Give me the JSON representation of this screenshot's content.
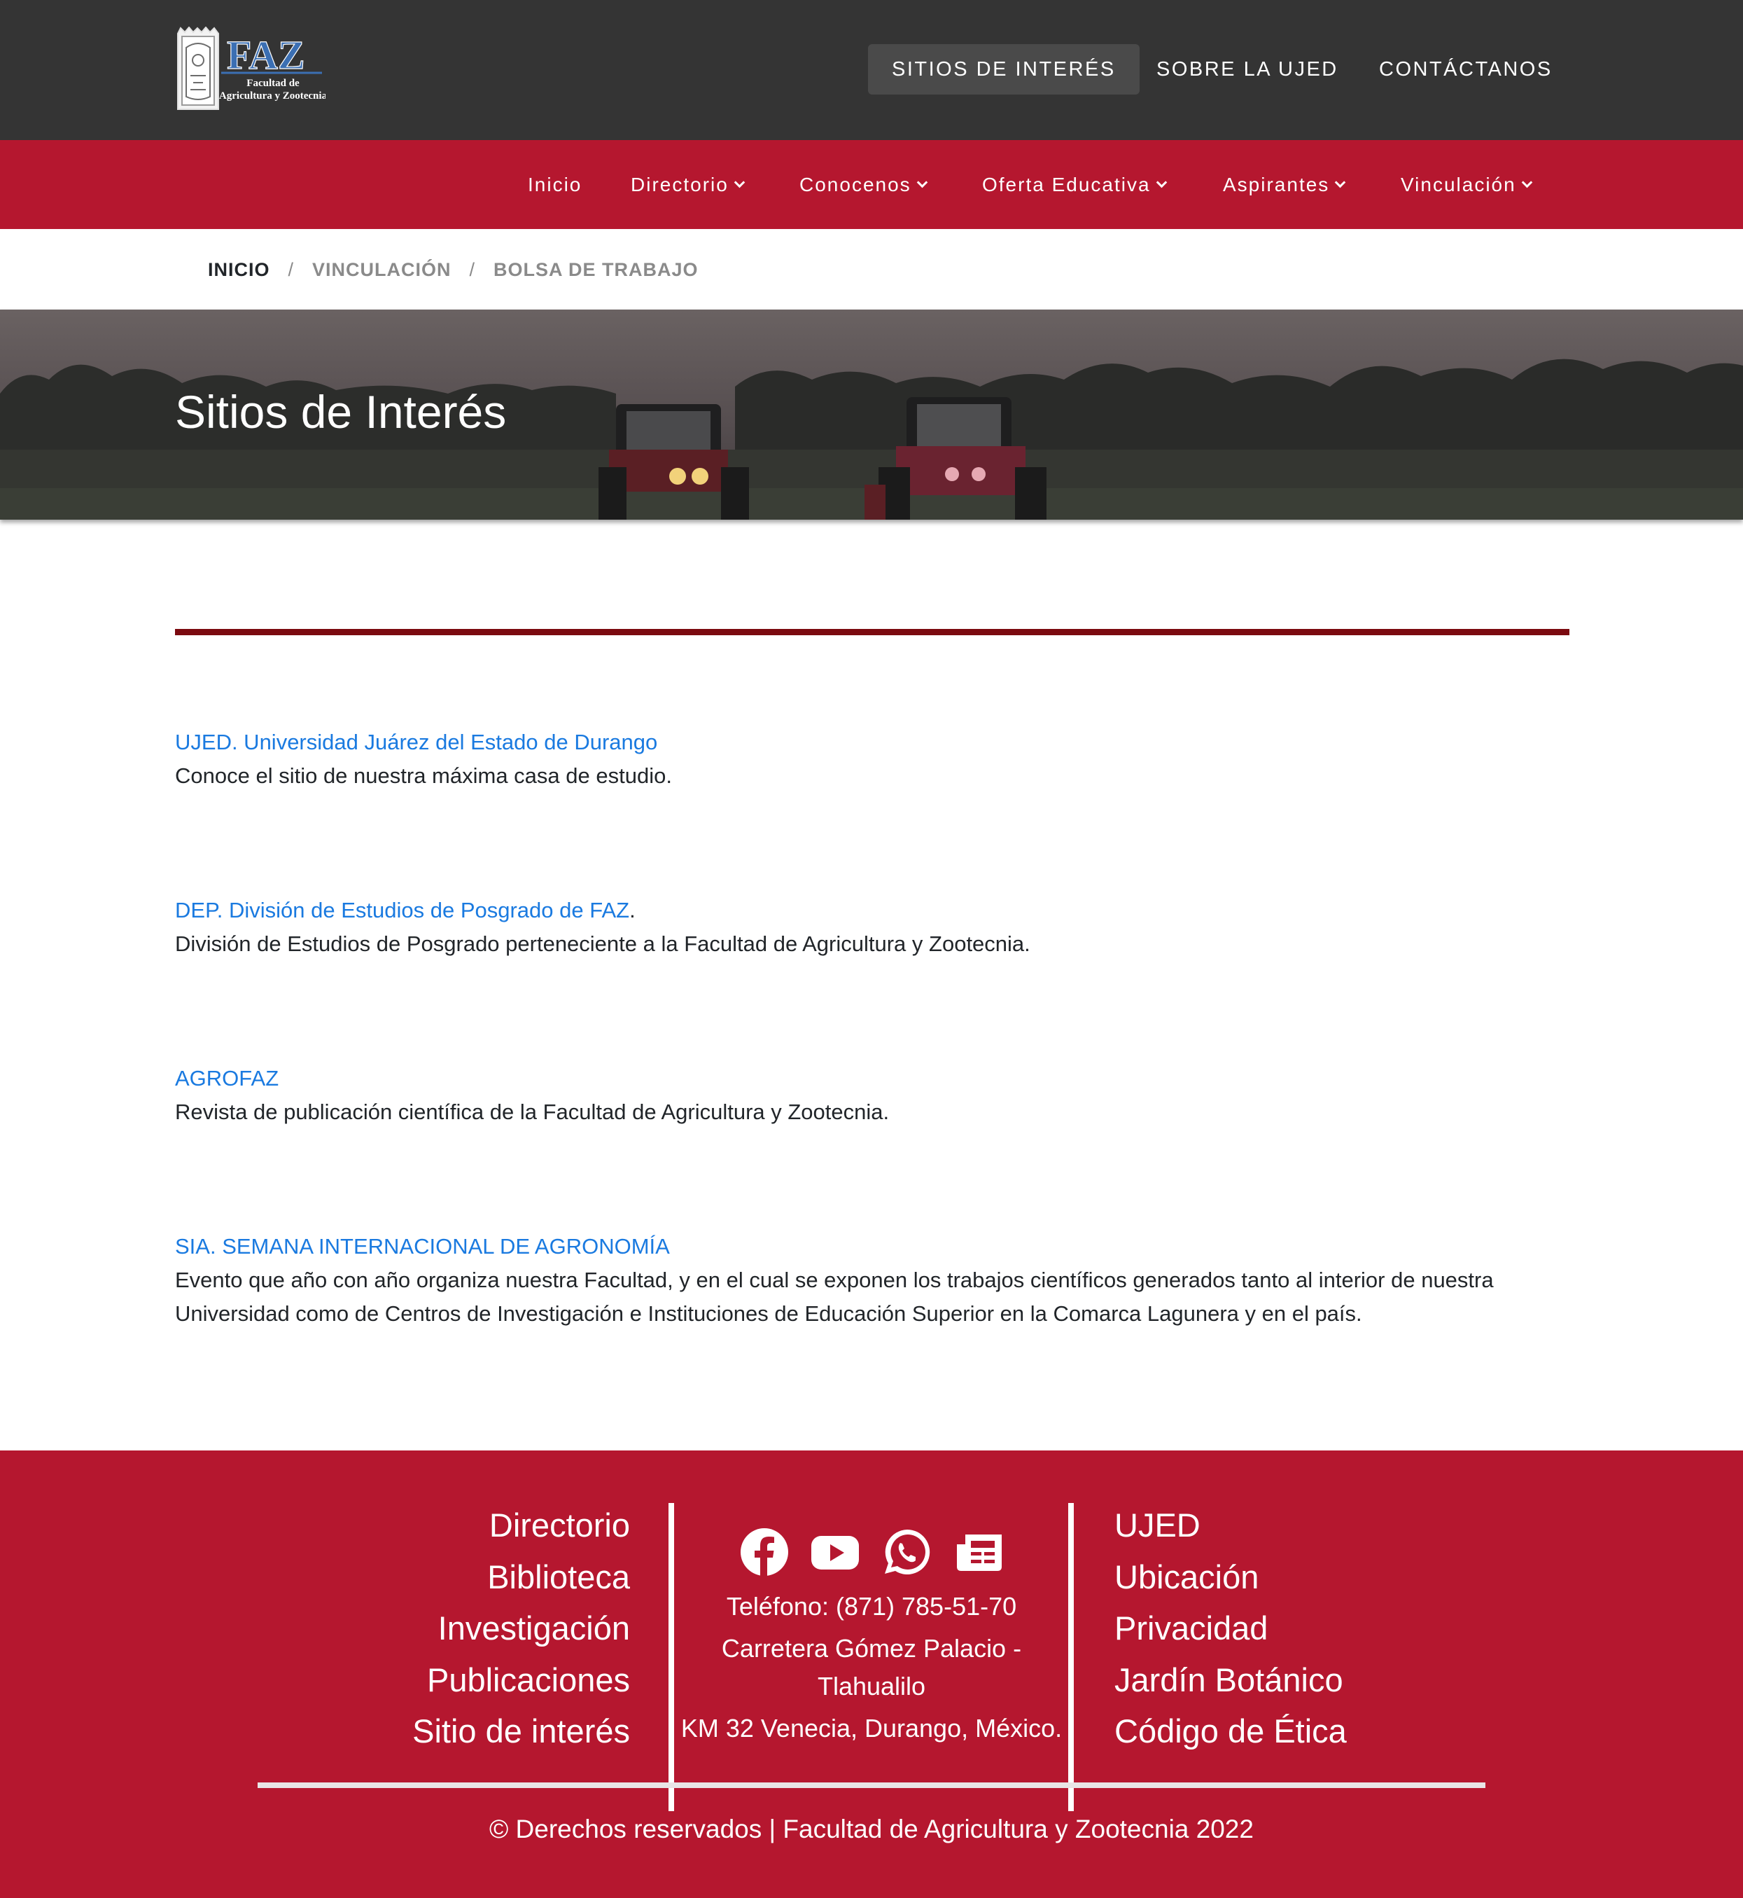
{
  "colors": {
    "topbar": "#343434",
    "brand_red": "#b5172f",
    "divider": "#7b0a10",
    "link": "#1a7ae0"
  },
  "logo": {
    "title": "FAZ",
    "subtitle_line1": "Facultad de",
    "subtitle_line2": "Agricultura y Zootecnia"
  },
  "top_nav": [
    {
      "label": "SITIOS DE INTERÉS",
      "active": true
    },
    {
      "label": "SOBRE LA UJED",
      "active": false
    },
    {
      "label": "CONTÁCTANOS",
      "active": false
    }
  ],
  "main_nav": [
    {
      "label": "Inicio",
      "dropdown": false
    },
    {
      "label": "Directorio",
      "dropdown": true
    },
    {
      "label": "Conocenos",
      "dropdown": true
    },
    {
      "label": "Oferta Educativa",
      "dropdown": true
    },
    {
      "label": "Aspirantes",
      "dropdown": true
    },
    {
      "label": "Vinculación",
      "dropdown": true
    }
  ],
  "breadcrumb": {
    "home": "INICIO",
    "items": [
      "VINCULACIÓN",
      "BOLSA DE TRABAJO"
    ],
    "separator": "/"
  },
  "hero": {
    "title": "Sitios de Interés"
  },
  "sites": [
    {
      "link": "UJED. Universidad Juárez del Estado de Durango",
      "suffix": "",
      "description": "Conoce el sitio de nuestra máxima casa de estudio."
    },
    {
      "link": "DEP. División de Estudios de Posgrado de FAZ",
      "suffix": ".",
      "description": "División de Estudios de Posgrado perteneciente a la Facultad de Agricultura y Zootecnia."
    },
    {
      "link": "AGROFAZ",
      "suffix": "",
      "description": "Revista de publicación científica de la Facultad de Agricultura y Zootecnia."
    },
    {
      "link": "SIA. SEMANA INTERNACIONAL DE AGRONOMÍA",
      "suffix": "",
      "description_line1": "Evento que año con año organiza nuestra Facultad, y en el cual se exponen los trabajos científicos generados tanto al interior de nuestra",
      "description_line2": "Universidad como de Centros de Investigación e Instituciones de Educación Superior en la Comarca Lagunera y en el país."
    }
  ],
  "footer": {
    "left_links": [
      "Directorio",
      "Biblioteca",
      "Investigación",
      "Publicaciones",
      "Sitio de interés"
    ],
    "right_links": [
      "UJED",
      "Ubicación",
      "Privacidad",
      "Jardín Botánico",
      "Código de Ética"
    ],
    "social_icons": [
      "facebook-icon",
      "youtube-icon",
      "whatsapp-icon",
      "news-icon"
    ],
    "phone": "Teléfono: (871) 785-51-70",
    "address_line1": "Carretera Gómez Palacio -",
    "address_line2": "Tlahualilo",
    "address_line3": "KM 32 Venecia, Durango, México.",
    "copyright": "© Derechos reservados | Facultad de Agricultura y Zootecnia 2022"
  }
}
